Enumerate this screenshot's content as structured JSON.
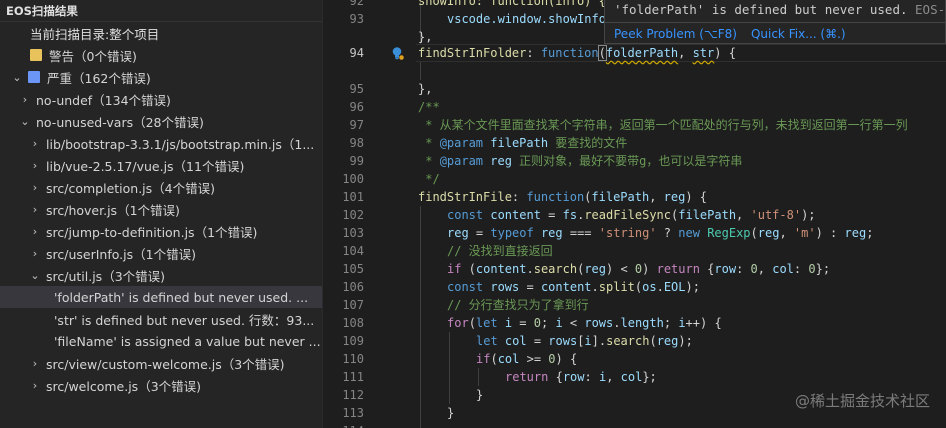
{
  "sidebar": {
    "title": "EOS扫描结果",
    "scope": "当前扫描目录:整个项目",
    "rows": [
      {
        "label": "警告（0个错误)",
        "color": "#e8c35b"
      },
      {
        "label": "严重（162个错误)",
        "color": "#6b96f5"
      },
      {
        "label": "no-undef（134个错误)"
      },
      {
        "label": "no-unused-vars（28个错误)"
      },
      {
        "label": "lib/bootstrap-3.3.1/js/bootstrap.min.js（1..."
      },
      {
        "label": "lib/vue-2.5.17/vue.js（11个错误)"
      },
      {
        "label": "src/completion.js（4个错误)"
      },
      {
        "label": "src/hover.js（1个错误)"
      },
      {
        "label": "src/jump-to-definition.js（1个错误)"
      },
      {
        "label": "src/userInfo.js（1个错误)"
      },
      {
        "label": "src/util.js（3个错误)"
      },
      {
        "label": "'folderPath' is defined but never used. ..."
      },
      {
        "label": "'str' is defined but never used. 行数：93..."
      },
      {
        "label": "'fileName' is assigned a value but never ..."
      },
      {
        "label": "src/view/custom-welcome.js（3个错误)"
      },
      {
        "label": "src/welcome.js（3个错误)"
      }
    ]
  },
  "editor": {
    "line_numbers": [
      "92",
      "93",
      "94",
      "95",
      "96",
      "97",
      "98",
      "99",
      "100",
      "101",
      "102",
      "103",
      "104",
      "105",
      "106",
      "107",
      "108",
      "109",
      "110",
      "111",
      "112",
      "113",
      "114"
    ],
    "current_line": "94",
    "code": {
      "l92_a": "showInfo: function(info) {",
      "l93_a": "vscode.window.showInfo",
      "l94_a": "findStrInFolder",
      "l94_b": ": ",
      "l94_c": "function",
      "l94_d": "(",
      "l94_e": "folderPath",
      "l94_f": ", ",
      "l94_g": "str",
      "l94_h": ") {",
      "l95": "},",
      "l97": "/**",
      "l98": " * 从某个文件里面查找某个字符串，返回第一个匹配处的行与列，未找到返回第一行第一列",
      "l99_a": " * ",
      "l99_b": "@param",
      "l99_c": " filePath",
      "l99_d": " 要查找的文件",
      "l100_a": " * ",
      "l100_b": "@param",
      "l100_c": " reg",
      "l100_d": " 正则对象，最好不要带g，也可以是字符串",
      "l101": " */",
      "l102_a": "findStrInFile",
      "l102_b": ": ",
      "l102_c": "function",
      "l102_d": "(",
      "l102_e": "filePath",
      "l102_f": ", ",
      "l102_g": "reg",
      "l102_h": ") {",
      "l103_a": "const",
      "l103_b": "content",
      "l103_c": " = ",
      "l103_d": "fs",
      "l103_e": ".",
      "l103_f": "readFileSync",
      "l103_g": "(",
      "l103_h": "filePath",
      "l103_i": ", ",
      "l103_j": "'utf-8'",
      "l103_k": ");",
      "l104_a": "reg",
      "l104_b": " = ",
      "l104_c": "typeof",
      "l104_d": " reg ",
      "l104_e": "===",
      "l104_f": " ",
      "l104_g": "'string'",
      "l104_h": " ? ",
      "l104_i": "new",
      "l104_j": " ",
      "l104_k": "RegExp",
      "l104_l": "(",
      "l104_m": "reg",
      "l104_n": ", ",
      "l104_o": "'m'",
      "l104_p": ") : ",
      "l104_q": "reg",
      "l104_r": ";",
      "l105": "// 没找到直接返回",
      "l106_a": "if",
      "l106_b": " (",
      "l106_c": "content",
      "l106_d": ".",
      "l106_e": "search",
      "l106_f": "(",
      "l106_g": "reg",
      "l106_h": ") < ",
      "l106_i": "0",
      "l106_j": ") ",
      "l106_k": "return",
      "l106_l": " {",
      "l106_m": "row",
      "l106_n": ": ",
      "l106_o": "0",
      "l106_p": ", ",
      "l106_q": "col",
      "l106_r": ": ",
      "l106_s": "0",
      "l106_t": "};",
      "l107_a": "const",
      "l107_b": "rows",
      "l107_c": " = ",
      "l107_d": "content",
      "l107_e": ".",
      "l107_f": "split",
      "l107_g": "(",
      "l107_h": "os",
      "l107_i": ".",
      "l107_j": "EOL",
      "l107_k": ");",
      "l108": "// 分行查找只为了拿到行",
      "l109_a": "for",
      "l109_b": "(",
      "l109_c": "let",
      "l109_d": " i",
      "l109_e": " = ",
      "l109_f": "0",
      "l109_g": "; ",
      "l109_h": "i",
      "l109_i": " < ",
      "l109_j": "rows",
      "l109_k": ".",
      "l109_l": "length",
      "l109_m": "; ",
      "l109_n": "i",
      "l109_o": "++) {",
      "l110_a": "let",
      "l110_b": " col",
      "l110_c": " = ",
      "l110_d": "rows",
      "l110_e": "[",
      "l110_f": "i",
      "l110_g": "].",
      "l110_h": "search",
      "l110_i": "(",
      "l110_j": "reg",
      "l110_k": ");",
      "l111_a": "if",
      "l111_b": "(",
      "l111_c": "col",
      "l111_d": " >= ",
      "l111_e": "0",
      "l111_f": ") {",
      "l112_a": "return",
      "l112_b": " {",
      "l112_c": "row",
      "l112_d": ": ",
      "l112_e": "i",
      "l112_f": ", ",
      "l112_g": "col",
      "l112_h": "};",
      "l113": "}",
      "l114": "}"
    }
  },
  "hover": {
    "message": "'folderPath' is defined but never used.",
    "source": "EOS-JS",
    "peek_problem": "Peek Problem (⌥F8)",
    "quick_fix": "Quick Fix... (⌘.)"
  },
  "watermark": "@稀土掘金技术社区"
}
